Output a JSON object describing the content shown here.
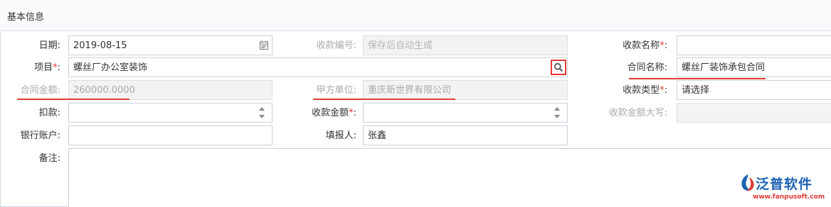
{
  "panel": {
    "title": "基本信息"
  },
  "form": {
    "date": {
      "label": "日期:",
      "value": "2019-08-15"
    },
    "receipt_no": {
      "label": "收款编号:",
      "placeholder": "保存后自动生成"
    },
    "receipt_name": {
      "label": "收款名称",
      "req": "*",
      "colon": ":",
      "value": ""
    },
    "project": {
      "label": "项目",
      "req": "*",
      "colon": ":",
      "value": "螺丝厂办公室装饰"
    },
    "contract_name": {
      "label": "合同名称:",
      "value": "螺丝厂装饰承包合同"
    },
    "contract_amount": {
      "label": "合同金额:",
      "value": "260000.0000"
    },
    "party_a": {
      "label": "甲方单位:",
      "value": "重庆新世界有限公司"
    },
    "receipt_type": {
      "label": "收款类型",
      "req": "*",
      "colon": ":",
      "value": "请选择"
    },
    "deduction": {
      "label": "扣款:",
      "value": ""
    },
    "receipt_amount": {
      "label": "收款金额",
      "req": "*",
      "colon": ":",
      "value": ""
    },
    "amount_upper": {
      "label": "收款金额大写:",
      "value": ""
    },
    "bank_account": {
      "label": "银行账户:",
      "value": ""
    },
    "filler": {
      "label": "填报人:",
      "value": "张鑫"
    },
    "remark": {
      "label": "备注:",
      "value": ""
    }
  },
  "watermark": {
    "name": "泛普软件",
    "url": "www.fanpusoft.com"
  },
  "colors": {
    "annotation_red": "#e53935",
    "brand_blue": "#1e62b3",
    "disabled_text": "#a9a9a9"
  },
  "icons": {
    "date": "calendar-icon",
    "project_lookup": "search-icon",
    "stepper": "spinner-arrows-icon"
  }
}
